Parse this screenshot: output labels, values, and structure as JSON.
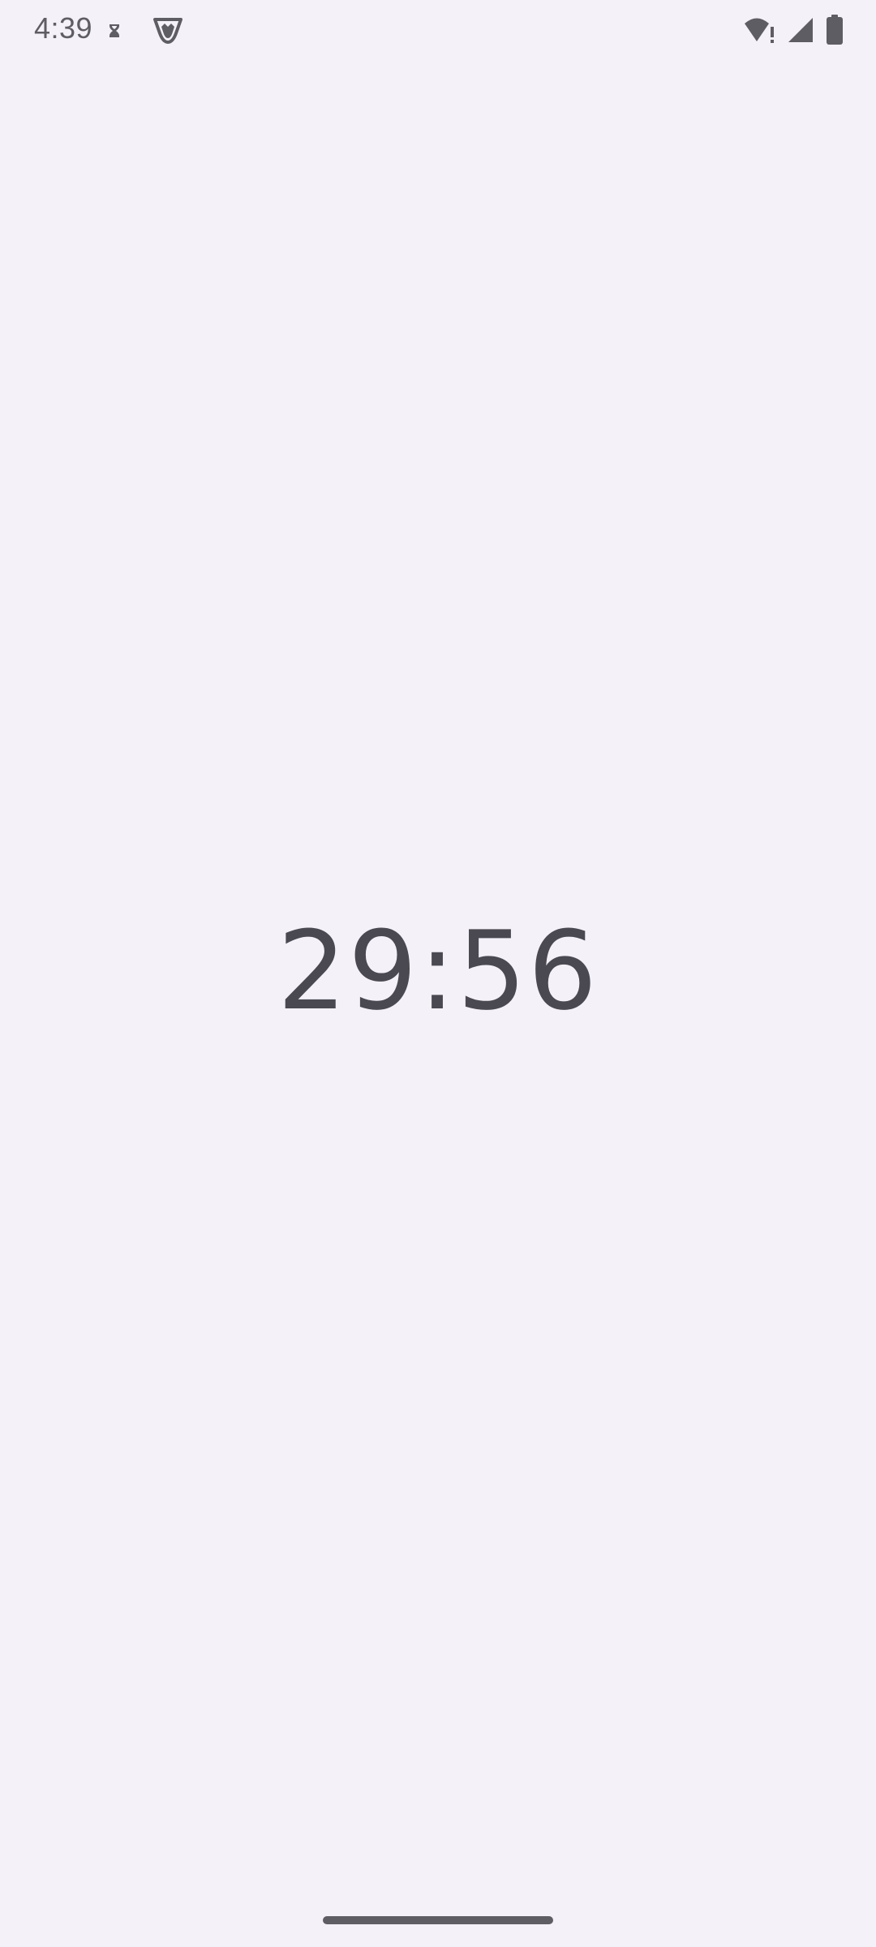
{
  "status_bar": {
    "time": "4:39",
    "left_icons": [
      "hourglass-icon",
      "shield-app-icon"
    ],
    "right_icons": [
      "wifi-alert-icon",
      "cell-signal-icon",
      "battery-icon"
    ]
  },
  "timer": {
    "display": "29:56"
  },
  "colors": {
    "background": "#f4f1f9",
    "timer_text": "#4a4850",
    "status_icons": "#5f5d64"
  }
}
